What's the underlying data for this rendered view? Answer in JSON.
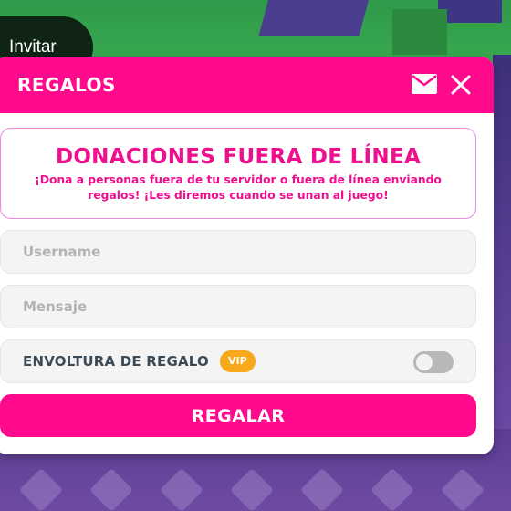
{
  "invite": {
    "label": "Invitar"
  },
  "modal": {
    "title": "REGALOS",
    "icons": {
      "mail": "mail-icon",
      "close": "close-icon"
    }
  },
  "notice": {
    "title": "DONACIONES FUERA DE LÍNEA",
    "body": "¡Dona a personas fuera de tu servidor o fuera de línea enviando regalos! ¡Les diremos cuando se unan al juego!"
  },
  "form": {
    "username": {
      "value": "",
      "placeholder": "Username"
    },
    "message": {
      "value": "",
      "placeholder": "Mensaje"
    },
    "gift_wrap": {
      "label": "ENVOLTURA DE REGALO",
      "badge": "VIP",
      "enabled": false
    },
    "submit_label": "REGALAR"
  },
  "colors": {
    "accent": "#ff0a8c",
    "vip": "#f7a81b",
    "label_text": "#3b4a55"
  }
}
